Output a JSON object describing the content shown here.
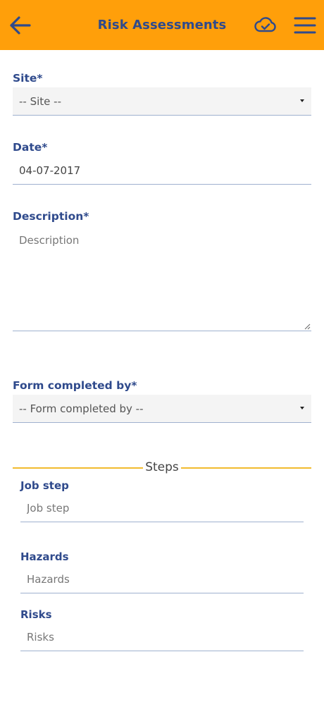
{
  "header": {
    "title": "Risk Assessments",
    "background": "#ff9f0a",
    "title_color": "#2f4a8c",
    "back_icon": "arrow-left-icon",
    "sync_icon": "cloud-check-icon",
    "menu_icon": "hamburger-menu-icon"
  },
  "form": {
    "site": {
      "label": "Site*",
      "value": "-- Site --"
    },
    "date": {
      "label": "Date*",
      "value": "04-07-2017"
    },
    "description": {
      "label": "Description*",
      "placeholder": "Description"
    },
    "completed_by": {
      "label": "Form completed by*",
      "value": "-- Form completed by --"
    }
  },
  "steps": {
    "title": "Steps",
    "accent": "#f2bb2e",
    "job_step": {
      "label": "Job step",
      "placeholder": "Job step"
    },
    "hazards": {
      "label": "Hazards",
      "placeholder": "Hazards"
    },
    "risks": {
      "label": "Risks",
      "placeholder": "Risks"
    }
  }
}
